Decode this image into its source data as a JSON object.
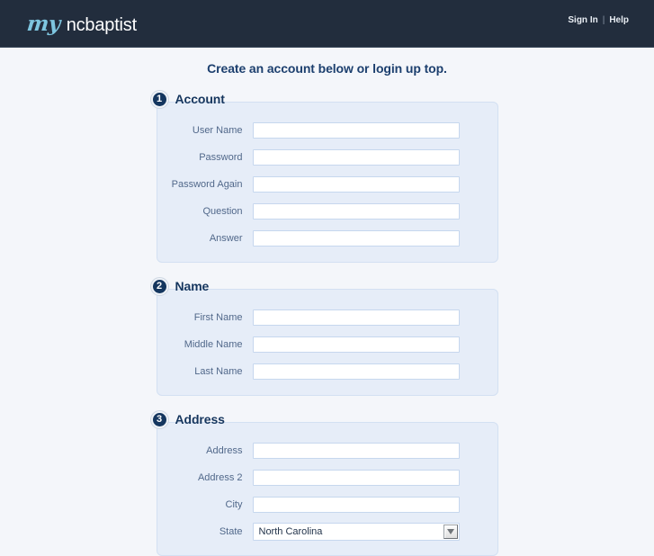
{
  "header": {
    "brand_script": "my",
    "brand_name": "ncbaptist",
    "links": {
      "sign_in": "Sign In",
      "separator": "|",
      "help": "Help"
    }
  },
  "page": {
    "title": "Create an account below or login up top."
  },
  "sections": [
    {
      "number": "1",
      "title": "Account",
      "fields": [
        {
          "label": "User Name",
          "type": "text",
          "value": "",
          "placeholder": ""
        },
        {
          "label": "Password",
          "type": "text",
          "value": "",
          "placeholder": ""
        },
        {
          "label": "Password Again",
          "type": "text",
          "value": "",
          "placeholder": ""
        },
        {
          "label": "Question",
          "type": "text",
          "value": "",
          "placeholder": ""
        },
        {
          "label": "Answer",
          "type": "text",
          "value": "",
          "placeholder": ""
        }
      ]
    },
    {
      "number": "2",
      "title": "Name",
      "fields": [
        {
          "label": "First Name",
          "type": "text",
          "value": "",
          "placeholder": ""
        },
        {
          "label": "Middle Name",
          "type": "text",
          "value": "",
          "placeholder": ""
        },
        {
          "label": "Last Name",
          "type": "text",
          "value": "",
          "placeholder": ""
        }
      ]
    },
    {
      "number": "3",
      "title": "Address",
      "fields": [
        {
          "label": "Address",
          "type": "text",
          "value": "",
          "placeholder": ""
        },
        {
          "label": "Address 2",
          "type": "text",
          "value": "",
          "placeholder": ""
        },
        {
          "label": "City",
          "type": "text",
          "value": "",
          "placeholder": ""
        },
        {
          "label": "State",
          "type": "select",
          "value": "North Carolina",
          "placeholder": ""
        }
      ]
    }
  ],
  "colors": {
    "header_bg": "#222d3d",
    "page_bg": "#f4f6fa",
    "panel_bg": "#e6edf8",
    "panel_border": "#d3e0f2",
    "accent_navy": "#14365f",
    "brand_script": "#7ec6e0",
    "label_text": "#51688a",
    "heading_text": "#16365e"
  }
}
